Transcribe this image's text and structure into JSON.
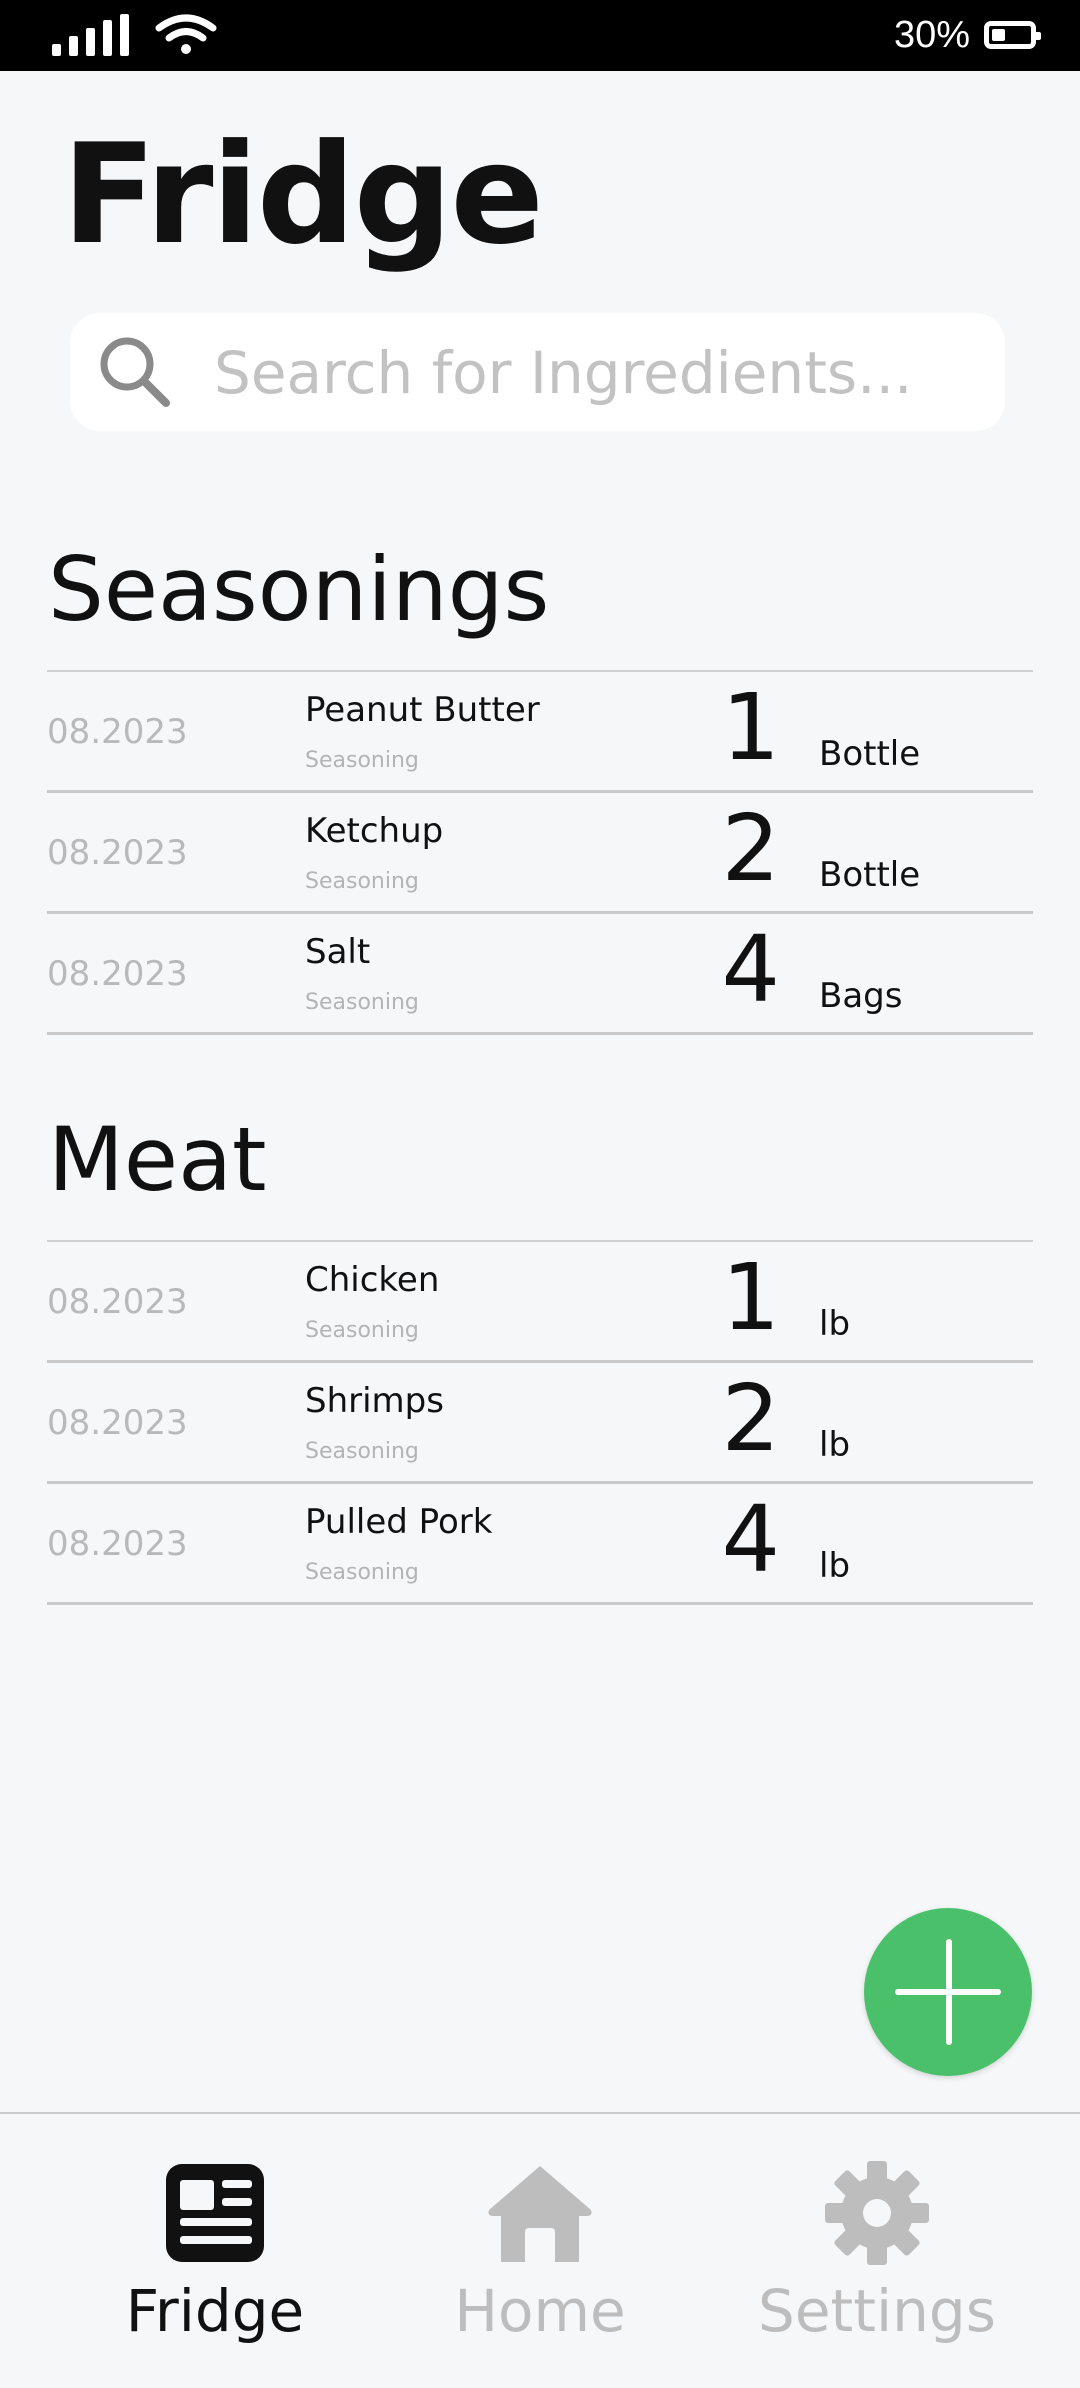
{
  "status_bar": {
    "battery": "30%"
  },
  "page_title": "Fridge",
  "search": {
    "placeholder": "Search for Ingredients..."
  },
  "sections": [
    {
      "title": "Seasonings",
      "items": [
        {
          "date": "08.2023",
          "name": "Peanut Butter",
          "category": "Seasoning",
          "quantity": "1",
          "unit": "Bottle"
        },
        {
          "date": "08.2023",
          "name": "Ketchup",
          "category": "Seasoning",
          "quantity": "2",
          "unit": "Bottle"
        },
        {
          "date": "08.2023",
          "name": "Salt",
          "category": "Seasoning",
          "quantity": "4",
          "unit": "Bags"
        }
      ]
    },
    {
      "title": "Meat",
      "items": [
        {
          "date": "08.2023",
          "name": "Chicken",
          "category": "Seasoning",
          "quantity": "1",
          "unit": "lb"
        },
        {
          "date": "08.2023",
          "name": "Shrimps",
          "category": "Seasoning",
          "quantity": "2",
          "unit": "lb"
        },
        {
          "date": "08.2023",
          "name": "Pulled Pork",
          "category": "Seasoning",
          "quantity": "4",
          "unit": "lb"
        }
      ]
    }
  ],
  "tab_bar": {
    "tabs": [
      {
        "label": "Fridge",
        "icon": "fridge-list-icon",
        "active": true
      },
      {
        "label": "Home",
        "icon": "home-icon",
        "active": false
      },
      {
        "label": "Settings",
        "icon": "gear-icon",
        "active": false
      }
    ]
  },
  "colors": {
    "accent": "#4ac06b",
    "background": "#f6f7f9",
    "muted_text": "#bdbdbd"
  }
}
